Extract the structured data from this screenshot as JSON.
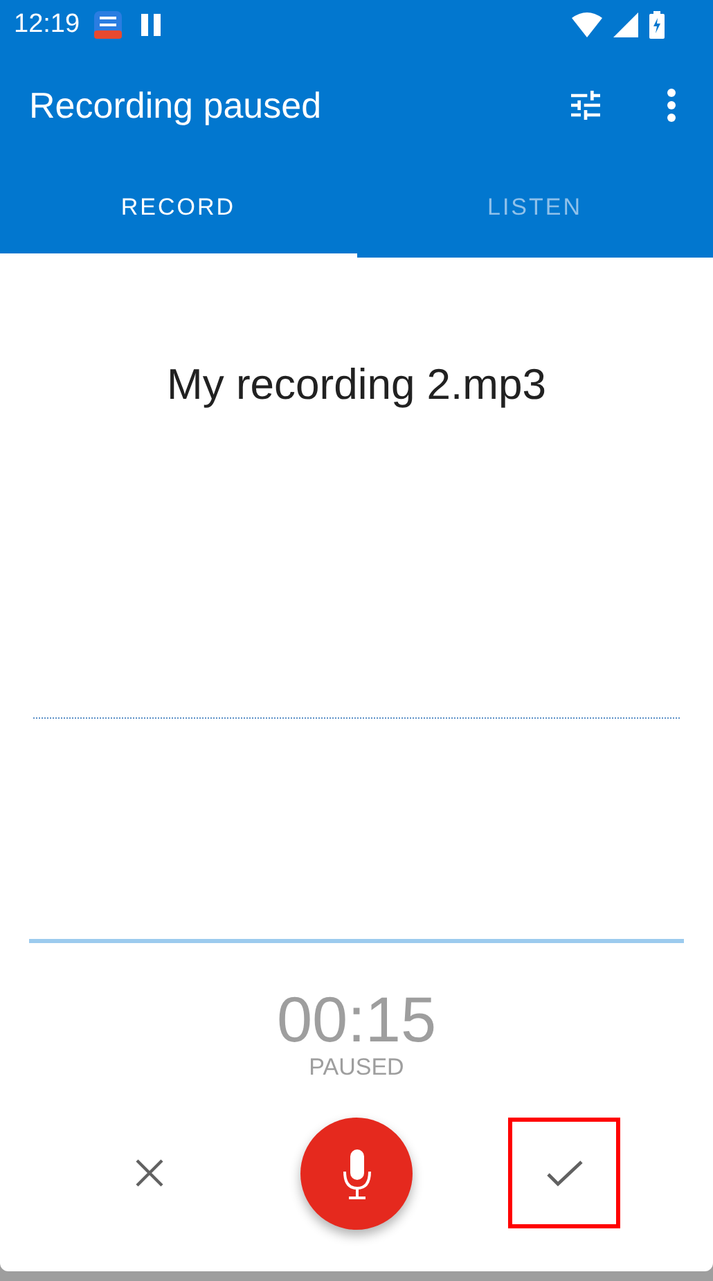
{
  "status_bar": {
    "time": "12:19"
  },
  "app_bar": {
    "title": "Recording paused"
  },
  "tabs": [
    {
      "label": "RECORD",
      "selected": true
    },
    {
      "label": "LISTEN",
      "selected": false
    }
  ],
  "recording": {
    "file_name": "My recording 2.mp3",
    "elapsed": "00:15",
    "state": "PAUSED"
  },
  "controls": [
    {
      "kind": "discard",
      "highlighted": false
    },
    {
      "kind": "record",
      "highlighted": false
    },
    {
      "kind": "save",
      "highlighted": true
    }
  ]
}
